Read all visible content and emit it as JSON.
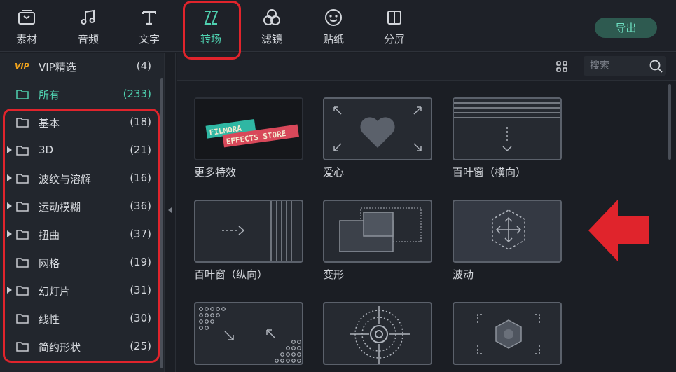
{
  "toolbar": {
    "tabs": [
      {
        "label": "素材",
        "icon": "media-icon"
      },
      {
        "label": "音频",
        "icon": "music-icon"
      },
      {
        "label": "文字",
        "icon": "text-icon"
      },
      {
        "label": "转场",
        "icon": "transition-icon",
        "active": true
      },
      {
        "label": "滤镜",
        "icon": "filter-icon"
      },
      {
        "label": "贴纸",
        "icon": "sticker-icon"
      },
      {
        "label": "分屏",
        "icon": "split-screen-icon"
      }
    ],
    "export_label": "导出"
  },
  "sidebar": {
    "vip": {
      "badge": "VIP",
      "label": "VIP精选",
      "count": "(4)"
    },
    "items": [
      {
        "label": "所有",
        "count": "(233)",
        "active": true
      },
      {
        "label": "基本",
        "count": "(18)"
      },
      {
        "label": "3D",
        "count": "(21)",
        "expandable": true
      },
      {
        "label": "波纹与溶解",
        "count": "(16)",
        "expandable": true
      },
      {
        "label": "运动模糊",
        "count": "(36)",
        "expandable": true
      },
      {
        "label": "扭曲",
        "count": "(37)",
        "expandable": true
      },
      {
        "label": "网格",
        "count": "(19)"
      },
      {
        "label": "幻灯片",
        "count": "(31)",
        "expandable": true
      },
      {
        "label": "线性",
        "count": "(30)"
      },
      {
        "label": "简约形状",
        "count": "(25)"
      }
    ]
  },
  "search": {
    "placeholder": "搜索"
  },
  "tiles": [
    {
      "label": "更多特效",
      "icon": "effects-store-icon",
      "banner_line1": "FILMORA",
      "banner_line2": "EFFECTS STORE"
    },
    {
      "label": "爱心",
      "icon": "heart-transition-icon"
    },
    {
      "label": "百叶窗（横向）",
      "icon": "horizontal-blinds-icon"
    },
    {
      "label": "百叶窗（纵向）",
      "icon": "vertical-blinds-icon"
    },
    {
      "label": "变形",
      "icon": "morph-transition-icon"
    },
    {
      "label": "波动",
      "icon": "wave-transition-icon"
    },
    {
      "label": "",
      "icon": "dots-diagonal-transition-icon"
    },
    {
      "label": "",
      "icon": "radial-zoom-transition-icon"
    },
    {
      "label": "",
      "icon": "hexagon-transition-icon"
    }
  ],
  "colors": {
    "accent": "#4fd1b0",
    "highlight": "#e0242c",
    "vip": "#f2a41c"
  }
}
